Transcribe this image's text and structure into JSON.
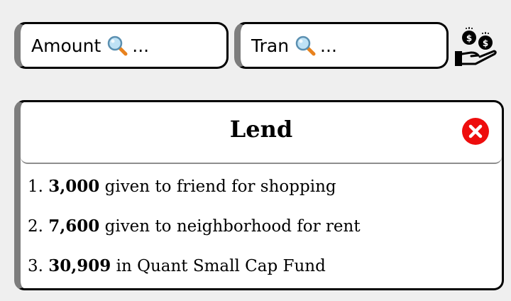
{
  "search": {
    "amount_label": "Amount",
    "tran_label": "Tran",
    "ellipsis": "...",
    "icon": "magnifying-glass-icon"
  },
  "header_icon": "money-hand-icon",
  "lend": {
    "title": "Lend",
    "close_icon": "close-icon",
    "items": [
      {
        "number": "1.",
        "amount": "3,000",
        "description": "given to friend for shopping"
      },
      {
        "number": "2.",
        "amount": "7,600",
        "description": "given to neighborhood for rent"
      },
      {
        "number": "3.",
        "amount": "30,909",
        "description": "in Quant Small Cap Fund"
      }
    ]
  },
  "colors": {
    "background": "#efefef",
    "border": "#000000",
    "accent_border": "#7d7d7d",
    "close_red": "#ee0d0d",
    "glass_handle": "#e8821e",
    "glass_lens": "#bfe2f5"
  }
}
